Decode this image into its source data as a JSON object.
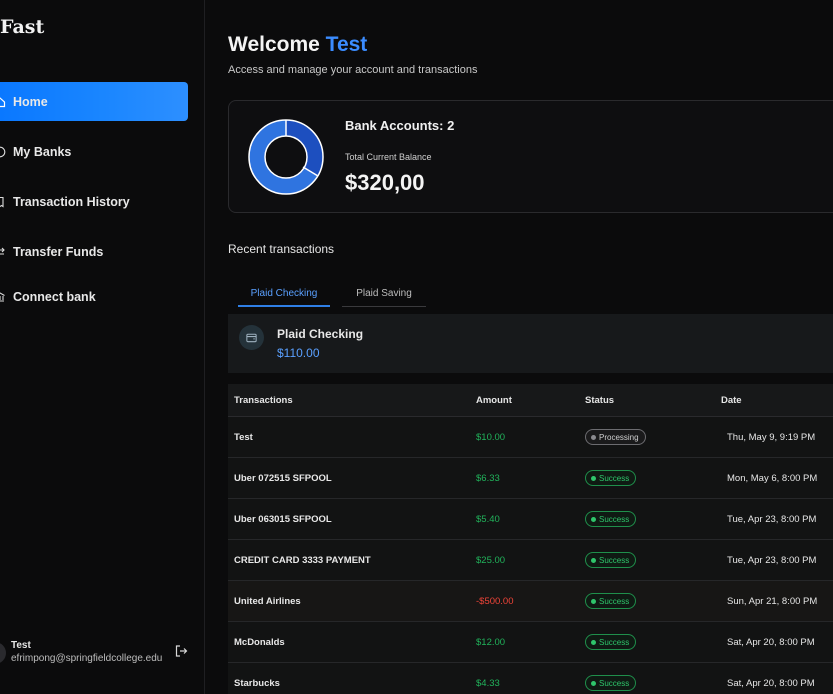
{
  "brand": "Fast",
  "sidebar": {
    "items": [
      {
        "label": "Home",
        "icon": "home-icon",
        "active": true
      },
      {
        "label": "My Banks",
        "icon": "dollar-circle-icon",
        "active": false
      },
      {
        "label": "Transaction History",
        "icon": "receipt-icon",
        "active": false
      },
      {
        "label": "Transfer Funds",
        "icon": "transfer-icon",
        "active": false
      },
      {
        "label": "Connect bank",
        "icon": "bank-plus-icon",
        "active": false
      }
    ],
    "user": {
      "name": "Test",
      "email": "efrimpong@springfieldcollege.edu"
    }
  },
  "header": {
    "greeting": "Welcome",
    "name": "Test",
    "subtitle": "Access and manage your account and transactions"
  },
  "balance": {
    "accounts_label": "Bank Accounts: 2",
    "total_label": "Total Current Balance",
    "total": "$320,00"
  },
  "recent": {
    "title": "Recent transactions"
  },
  "tabs": [
    {
      "label": "Plaid Checking",
      "active": true
    },
    {
      "label": "Plaid Saving",
      "active": false
    }
  ],
  "account": {
    "name": "Plaid Checking",
    "balance": "$110.00"
  },
  "table": {
    "headers": [
      "Transactions",
      "Amount",
      "Status",
      "Date"
    ],
    "rows": [
      {
        "name": "Test",
        "amount": "$10.00",
        "status": "Processing",
        "date": "Thu, May 9, 9:19 PM"
      },
      {
        "name": "Uber 072515 SFPOOL",
        "amount": "$6.33",
        "status": "Success",
        "date": "Mon, May 6, 8:00 PM"
      },
      {
        "name": "Uber 063015 SFPOOL",
        "amount": "$5.40",
        "status": "Success",
        "date": "Tue, Apr 23, 8:00 PM"
      },
      {
        "name": "CREDIT CARD 3333 PAYMENT",
        "amount": "$25.00",
        "status": "Success",
        "date": "Tue, Apr 23, 8:00 PM"
      },
      {
        "name": "United Airlines",
        "amount": "-$500.00",
        "status": "Success",
        "date": "Sun, Apr 21, 8:00 PM"
      },
      {
        "name": "McDonalds",
        "amount": "$12.00",
        "status": "Success",
        "date": "Sat, Apr 20, 8:00 PM"
      },
      {
        "name": "Starbucks",
        "amount": "$4.33",
        "status": "Success",
        "date": "Sat, Apr 20, 8:00 PM"
      }
    ]
  },
  "colors": {
    "accent": "#0a78ff",
    "success": "#21b35b",
    "negative": "#f04438",
    "donut_dark": "#1d4fbf",
    "donut_light": "#2f74e0"
  }
}
